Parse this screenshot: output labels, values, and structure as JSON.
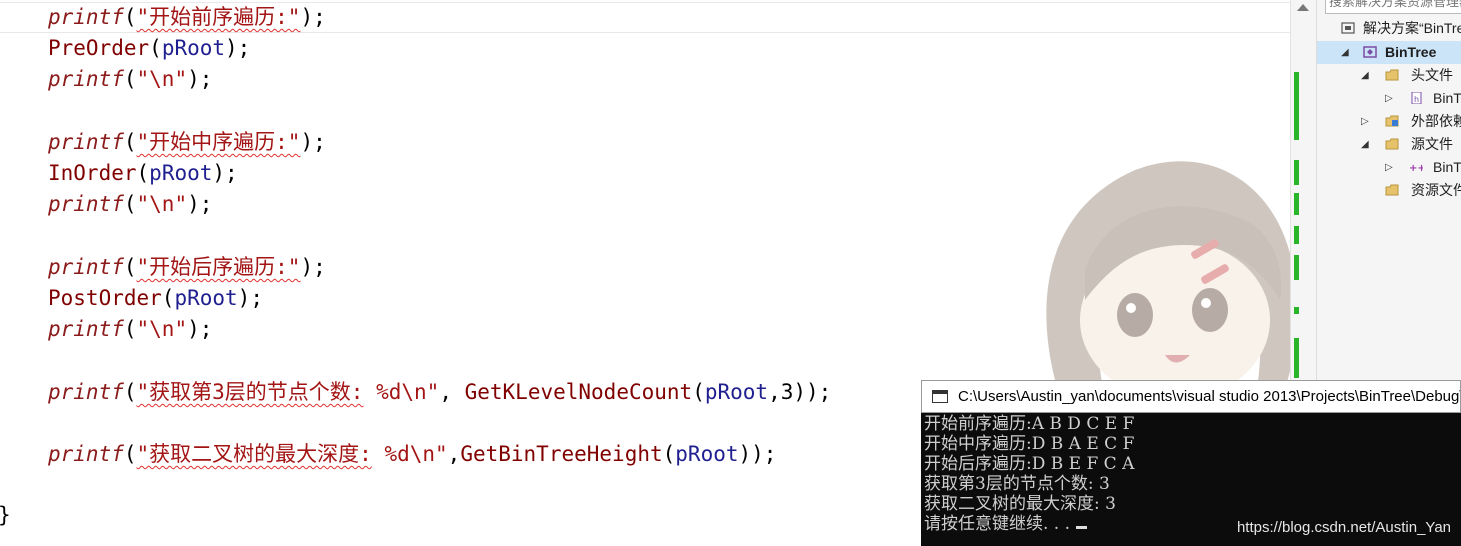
{
  "editor": {
    "lines": [
      {
        "fn": "printf",
        "open": "(",
        "str": "\"开始前序遍历:\"",
        "close": ");"
      },
      {
        "id": "PreOrder",
        "open": "(",
        "arg": "pRoot",
        "close": ");"
      },
      {
        "fn": "printf",
        "open": "(",
        "str": "\"\\n\"",
        "close": ");"
      },
      {
        "fn": "printf",
        "open": "(",
        "str": "\"开始中序遍历:\"",
        "close": ");"
      },
      {
        "id": "InOrder",
        "open": "(",
        "arg": "pRoot",
        "close": ");"
      },
      {
        "fn": "printf",
        "open": "(",
        "str": "\"\\n\"",
        "close": ");"
      },
      {
        "fn": "printf",
        "open": "(",
        "str": "\"开始后序遍历:\"",
        "close": ");"
      },
      {
        "id": "PostOrder",
        "open": "(",
        "arg": "pRoot",
        "close": ");"
      },
      {
        "fn": "printf",
        "open": "(",
        "str": "\"\\n\"",
        "close": ");"
      },
      {
        "fn": "printf",
        "open": "(",
        "str_a": "\"获取第3层的节点个数:",
        "str_b": " %d\\n\"",
        "sep": ", ",
        "call": "GetKLevelNodeCount",
        "call_open": "(",
        "arg": "pRoot",
        "rest": ",3));"
      },
      {
        "fn": "printf",
        "open": "(",
        "str_a": "\"获取二叉树的最大深度:",
        "str_b": " %d\\n\"",
        "sep": ",",
        "call": "GetBinTreeHeight",
        "call_open": "(",
        "arg": "pRoot",
        "rest": "));"
      }
    ],
    "closing_brace": "}"
  },
  "solution_explorer": {
    "search_placeholder": "搜索解决方案资源管理器",
    "items": [
      {
        "label": "解决方案“BinTree”",
        "icon": "solution-icon",
        "level": 0,
        "expander": "none"
      },
      {
        "label": "BinTree",
        "icon": "project-icon",
        "level": 0,
        "expander": "expanded",
        "selected": true
      },
      {
        "label": "头文件",
        "icon": "folder-icon",
        "level": 1,
        "expander": "expanded"
      },
      {
        "label": "BinTree.h",
        "icon": "header-file-icon",
        "level": 2,
        "expander": "collapsed"
      },
      {
        "label": "外部依赖项",
        "icon": "external-deps-icon",
        "level": 1,
        "expander": "collapsed"
      },
      {
        "label": "源文件",
        "icon": "folder-icon",
        "level": 1,
        "expander": "expanded"
      },
      {
        "label": "BinTree.cpp",
        "icon": "cpp-file-icon",
        "level": 2,
        "expander": "collapsed"
      },
      {
        "label": "资源文件",
        "icon": "folder-icon",
        "level": 1,
        "expander": "none"
      }
    ]
  },
  "console": {
    "title": "C:\\Users\\Austin_yan\\documents\\visual studio 2013\\Projects\\BinTree\\Debug\\BinTree.exe",
    "lines": [
      "开始前序遍历:A B D C E F",
      "开始中序遍历:D B A E C F",
      "开始后序遍历:D B E F C A",
      "获取第3层的节点个数: 3",
      "获取二叉树的最大深度: 3",
      "请按任意键继续. . ."
    ],
    "watermark": "https://blog.csdn.net/Austin_Yan"
  },
  "colors": {
    "keyword_fn": "#8b1a1a",
    "string": "#a31515",
    "argument": "#1f1f8f",
    "change_bar": "#29b529",
    "console_bg": "#0c0c0c"
  }
}
